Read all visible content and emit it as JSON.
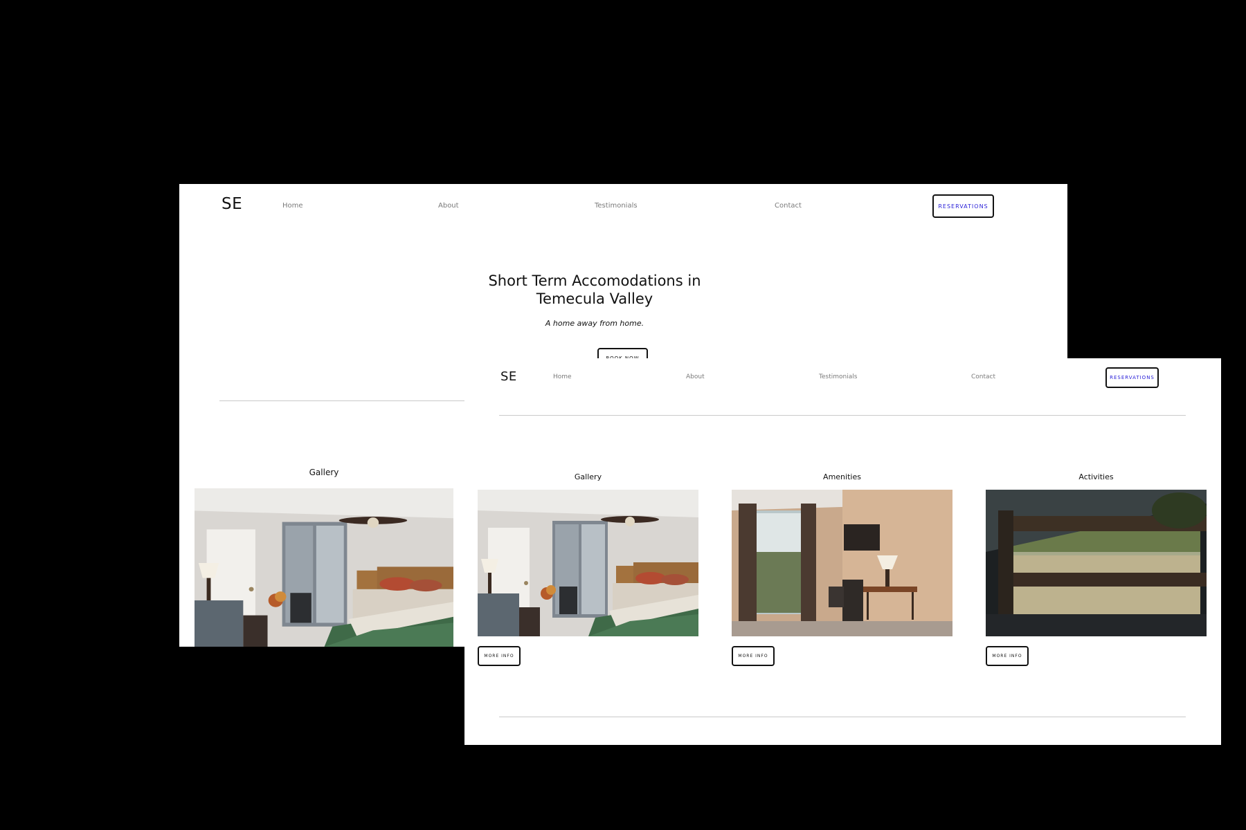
{
  "back_page": {
    "logo": "SE",
    "nav": [
      "Home",
      "About",
      "Testimonials",
      "Contact"
    ],
    "reservations_label": "RESERVATIONS",
    "hero_title": "Short Term Accomodations in Temecula Valley",
    "hero_tagline": "A home away from home.",
    "book_now_label": "BOOK NOW",
    "gallery_label": "Gallery"
  },
  "front_page": {
    "logo": "SE",
    "nav": [
      "Home",
      "About",
      "Testimonials",
      "Contact"
    ],
    "reservations_label": "RESERVATIONS",
    "cards": [
      {
        "label": "Gallery",
        "button": "MORE INFO"
      },
      {
        "label": "Amenities",
        "button": "MORE INFO"
      },
      {
        "label": "Activities",
        "button": "MORE INFO"
      }
    ]
  },
  "colors": {
    "backdrop": "#000000",
    "page_bg": "#ffffff",
    "nav_text": "#7a7a7a",
    "reservations_text": "#2a20d8",
    "divider": "#c9c9c9"
  }
}
